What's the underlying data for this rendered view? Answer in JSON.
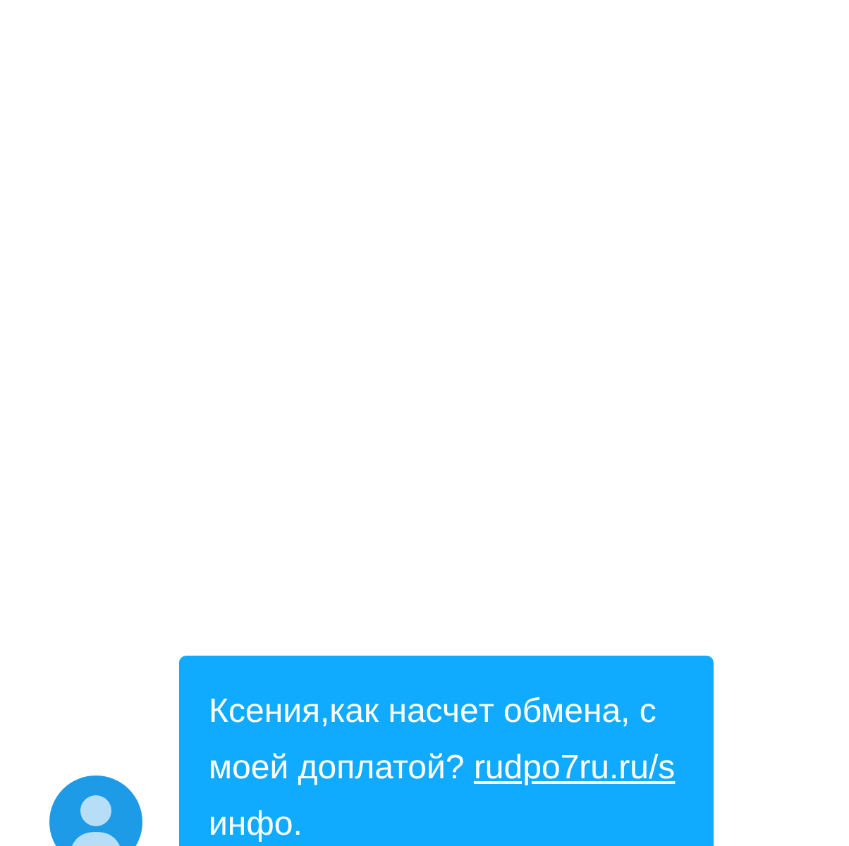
{
  "message": {
    "text": "Ксения,как насчeт обмена, с моей доплатой?",
    "link": "rudpo7ru.ru/s",
    "text_after": "инфо."
  }
}
